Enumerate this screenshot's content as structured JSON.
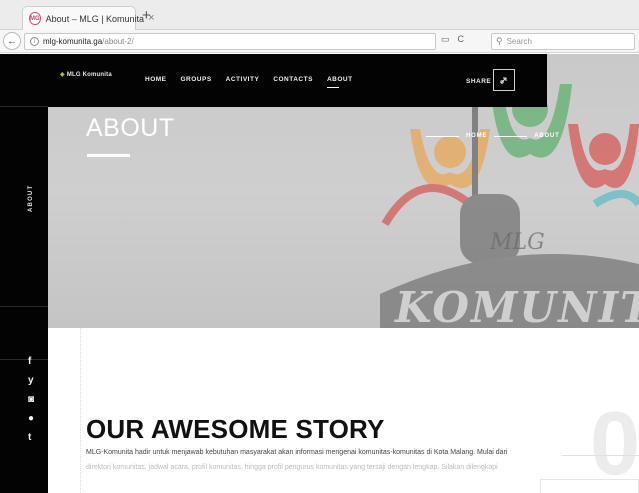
{
  "browser": {
    "tab_title": "About – MLG | Komunita",
    "tab_close": "×",
    "new_tab": "+",
    "favicon_text": "MG",
    "back": "←",
    "info": "i",
    "url_host": "mlg-komunita.ga",
    "url_path": "/about-2/",
    "reader_icon": "▭",
    "reload_icon": "C",
    "search_placeholder": "Search"
  },
  "site": {
    "logo_text": "MLG Komunita",
    "nav": [
      {
        "label": "HOME"
      },
      {
        "label": "GROUPS"
      },
      {
        "label": "ACTIVITY"
      },
      {
        "label": "CONTACTS"
      },
      {
        "label": "ABOUT"
      }
    ],
    "share_label": "SHARE"
  },
  "hero": {
    "title": "ABOUT",
    "breadcrumb": [
      "HOME",
      "ABOUT"
    ],
    "art_text": "KOMUNITA",
    "art_small_text": "MLG"
  },
  "rail": {
    "label": "ABOUT",
    "social": [
      {
        "icon": "facebook-icon",
        "glyph": "f"
      },
      {
        "icon": "twitter-icon",
        "glyph": "y"
      },
      {
        "icon": "instagram-icon",
        "glyph": "◙"
      },
      {
        "icon": "dribbble-icon",
        "glyph": "●"
      },
      {
        "icon": "tumblr-icon",
        "glyph": "t"
      }
    ]
  },
  "story": {
    "title_light": "OUR AWESOME ",
    "title_bold": "STORY",
    "line1": "MLG-Komunita hadir untuk menjawab kebutuhan masyarakat akan informasi mengenai komunitas-komunitas di Kota Malang. Mulai dari",
    "line2": "direktori komunitas, jadwal acara, profil komunitas, hingga profil pengurus komunitas yang tersaji dengan lengkap. Silakan dilengkapi",
    "big_number": "0"
  },
  "colors": {
    "nav_bg": "#030303",
    "hero_bg": "#c9c9c9",
    "art_red": "#d8322e",
    "art_green": "#3aa64f",
    "art_orange": "#f29a2e",
    "art_teal": "#3bb7c4"
  }
}
